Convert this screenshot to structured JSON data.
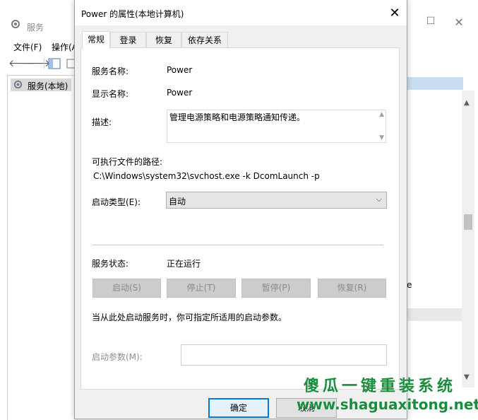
{
  "background_window": {
    "title": "服务",
    "menu": [
      "文件(F)",
      "操作(A)"
    ],
    "tree_item": "服务(本地)",
    "fragment_text": "e"
  },
  "dialog": {
    "title": "Power 的属性(本地计算机)",
    "close_glyph": "✕",
    "tabs": [
      "常规",
      "登录",
      "恢复",
      "依存关系"
    ],
    "active_tab": "常规",
    "fields": {
      "service_name_label": "服务名称:",
      "service_name_value": "Power",
      "display_name_label": "显示名称:",
      "display_name_value": "Power",
      "description_label": "描述:",
      "description_value": "管理电源策略和电源策略通知传递。",
      "path_label": "可执行文件的路径:",
      "path_value": "C:\\Windows\\system32\\svchost.exe -k DcomLaunch -p",
      "startup_type_label": "启动类型(E):",
      "startup_type_value": "自动",
      "status_label": "服务状态:",
      "status_value": "正在运行",
      "hint_text": "当从此处启动服务时，你可指定所适用的启动参数。",
      "params_label": "启动参数(M):",
      "params_value": ""
    },
    "service_buttons": [
      "启动(S)",
      "停止(T)",
      "暂停(P)",
      "恢复(R)"
    ],
    "ok_label": "确定",
    "cancel_label": "取消"
  },
  "watermark": {
    "line1": "傻瓜一键重装系统",
    "line2": "www.shaguaxitong.net"
  },
  "colors": {
    "accent": "#0078d7",
    "dialog_bg": "#f0f0f0",
    "panel_bg": "#ffffff",
    "disabled_text": "#8a8a8a",
    "selected_header": "#c9dff1",
    "watermark_green": "#1a8d3c"
  }
}
